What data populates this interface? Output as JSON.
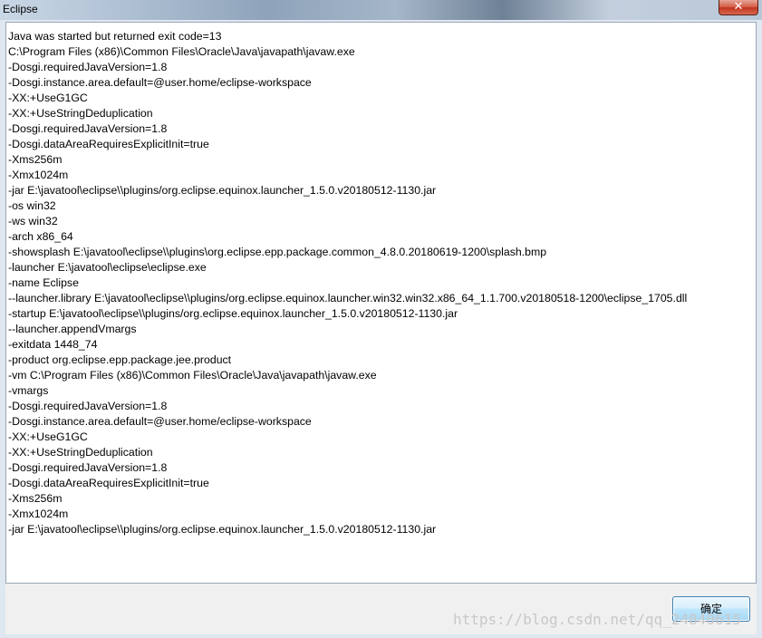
{
  "window": {
    "title": "Eclipse",
    "close_label": "✕"
  },
  "message": {
    "lines": [
      "Java was started but returned exit code=13",
      "C:\\Program Files (x86)\\Common Files\\Oracle\\Java\\javapath\\javaw.exe",
      "-Dosgi.requiredJavaVersion=1.8",
      "-Dosgi.instance.area.default=@user.home/eclipse-workspace",
      "-XX:+UseG1GC",
      "-XX:+UseStringDeduplication",
      "-Dosgi.requiredJavaVersion=1.8",
      "-Dosgi.dataAreaRequiresExplicitInit=true",
      "-Xms256m",
      "-Xmx1024m",
      "-jar E:\\javatool\\eclipse\\\\plugins/org.eclipse.equinox.launcher_1.5.0.v20180512-1130.jar",
      "-os win32",
      "-ws win32",
      "-arch x86_64",
      "-showsplash E:\\javatool\\eclipse\\\\plugins\\org.eclipse.epp.package.common_4.8.0.20180619-1200\\splash.bmp",
      "-launcher E:\\javatool\\eclipse\\eclipse.exe",
      "-name Eclipse",
      "--launcher.library E:\\javatool\\eclipse\\\\plugins/org.eclipse.equinox.launcher.win32.win32.x86_64_1.1.700.v20180518-1200\\eclipse_1705.dll",
      "-startup E:\\javatool\\eclipse\\\\plugins/org.eclipse.equinox.launcher_1.5.0.v20180512-1130.jar",
      "--launcher.appendVmargs",
      "-exitdata 1448_74",
      "-product org.eclipse.epp.package.jee.product",
      "-vm C:\\Program Files (x86)\\Common Files\\Oracle\\Java\\javapath\\javaw.exe",
      "-vmargs",
      "-Dosgi.requiredJavaVersion=1.8",
      "-Dosgi.instance.area.default=@user.home/eclipse-workspace",
      "-XX:+UseG1GC",
      "-XX:+UseStringDeduplication",
      "-Dosgi.requiredJavaVersion=1.8",
      "-Dosgi.dataAreaRequiresExplicitInit=true",
      "-Xms256m",
      "-Xmx1024m",
      "-jar E:\\javatool\\eclipse\\\\plugins/org.eclipse.equinox.launcher_1.5.0.v20180512-1130.jar"
    ]
  },
  "buttons": {
    "ok_label": "确定"
  },
  "watermark": {
    "text": "https://blog.csdn.net/qq_24840615"
  }
}
